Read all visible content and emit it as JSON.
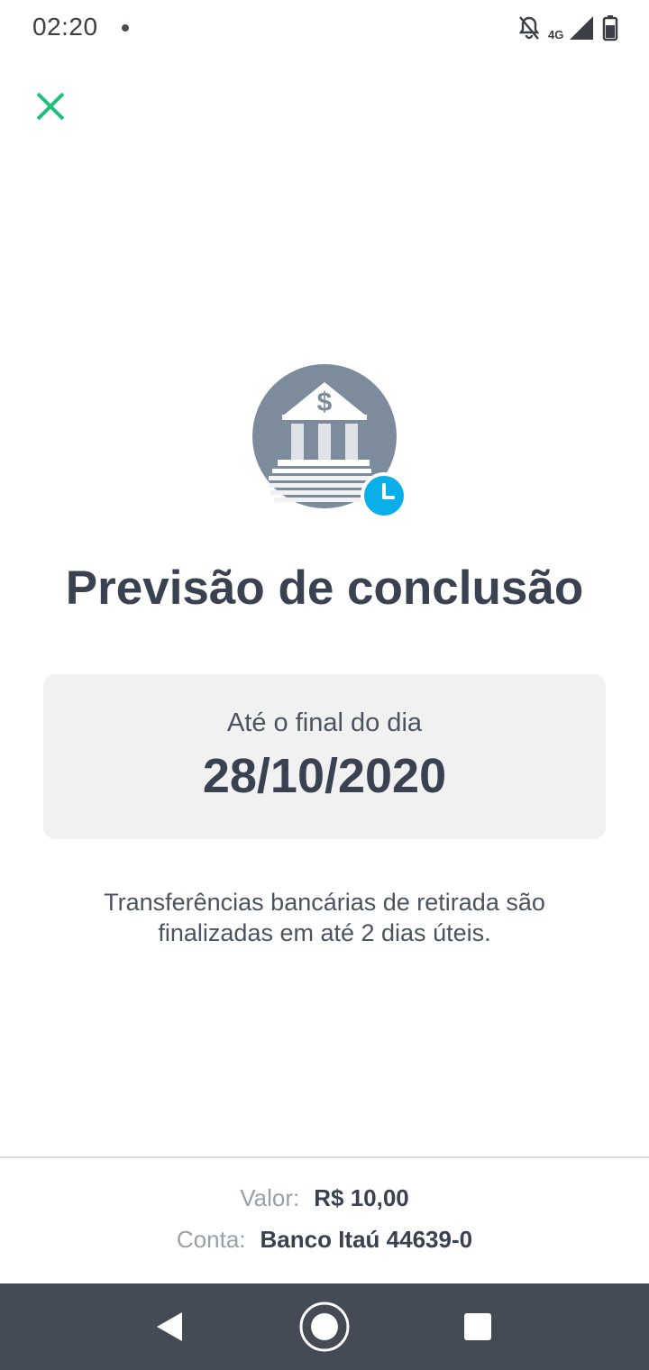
{
  "status_bar": {
    "time": "02:20",
    "network": "4G"
  },
  "title": "Previsão de conclusão",
  "date_card": {
    "label": "Até o final do dia",
    "date": "28/10/2020"
  },
  "info_text": "Transferências bancárias de retirada são finalizadas em até 2 dias úteis.",
  "summary": {
    "valor_label": "Valor:",
    "valor_value": "R$ 10,00",
    "conta_label": "Conta:",
    "conta_value": "Banco Itaú 44639-0"
  },
  "icons": {
    "close": "close-icon",
    "hero": "bank-clock-icon",
    "nav_back": "back-icon",
    "nav_home": "home-icon",
    "nav_recent": "recent-apps-icon"
  },
  "colors": {
    "accent_green": "#1fbf79",
    "clock_blue": "#0aaee8",
    "bank_gray": "#7d8c9c",
    "text_dark": "#3a4150",
    "nav_bg": "#454b55"
  }
}
